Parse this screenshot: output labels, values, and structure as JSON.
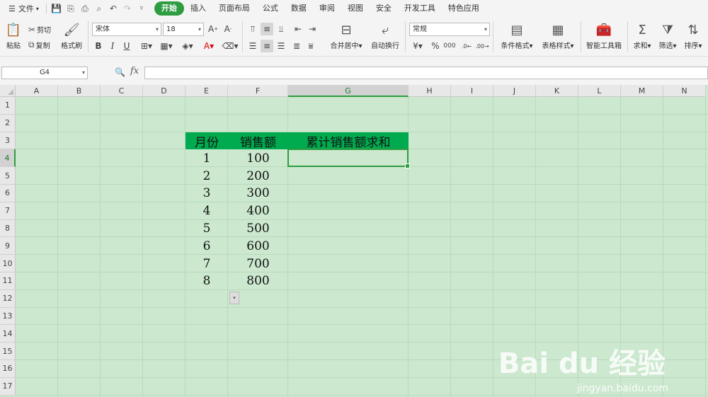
{
  "menu": {
    "file_label": "文件",
    "tabs": [
      {
        "label": "开始",
        "active": true
      },
      {
        "label": "插入"
      },
      {
        "label": "页面布局"
      },
      {
        "label": "公式"
      },
      {
        "label": "数据"
      },
      {
        "label": "审阅"
      },
      {
        "label": "视图"
      },
      {
        "label": "安全"
      },
      {
        "label": "开发工具"
      },
      {
        "label": "特色应用"
      }
    ]
  },
  "ribbon": {
    "paste": "粘贴",
    "cut": "剪切",
    "copy": "复制",
    "format_painter": "格式刷",
    "font_name": "宋体",
    "font_size": "18",
    "merge_center": "合并居中",
    "wrap_text": "自动换行",
    "number_format": "常规",
    "conditional_format": "条件格式",
    "table_style": "表格样式",
    "smart_toolbox": "智能工具箱",
    "sum": "求和",
    "filter": "筛选",
    "sort": "排序"
  },
  "formula_bar": {
    "name_box": "G4",
    "fx": "fx",
    "formula": ""
  },
  "sheet": {
    "columns": [
      "A",
      "B",
      "C",
      "D",
      "E",
      "F",
      "G",
      "H",
      "I",
      "J",
      "K",
      "L",
      "M",
      "N"
    ],
    "rows": [
      "1",
      "2",
      "3",
      "4",
      "5",
      "6",
      "7",
      "8",
      "9",
      "10",
      "11",
      "12",
      "13",
      "14",
      "15",
      "16",
      "17"
    ],
    "selected_cell": "G4",
    "headers": [
      "月份",
      "销售额",
      "累计销售额求和"
    ],
    "months": [
      "1",
      "2",
      "3",
      "4",
      "5",
      "6",
      "7",
      "8"
    ],
    "sales": [
      "100",
      "200",
      "300",
      "400",
      "500",
      "600",
      "700",
      "800"
    ]
  },
  "colors": {
    "accent": "#2e9c41",
    "header_fill": "#00aa4f",
    "sheet_bg": "#cce8cf"
  },
  "watermark": {
    "logo": "Bai du 经验",
    "url": "jingyan.baidu.com"
  }
}
